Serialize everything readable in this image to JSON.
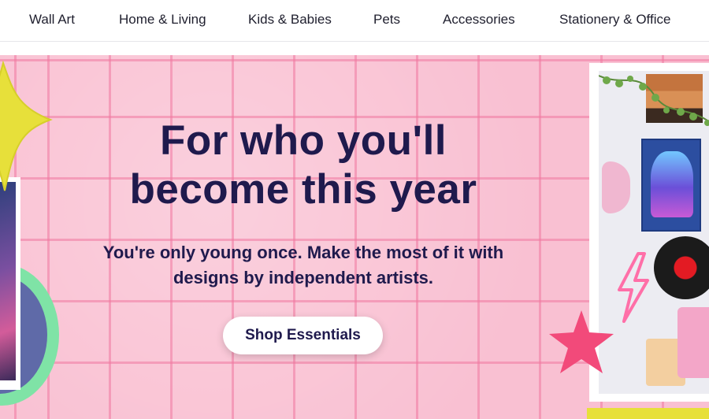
{
  "nav": {
    "items": [
      {
        "label": "Wall Art"
      },
      {
        "label": "Home & Living"
      },
      {
        "label": "Kids & Babies"
      },
      {
        "label": "Pets"
      },
      {
        "label": "Accessories"
      },
      {
        "label": "Stationery & Office"
      }
    ]
  },
  "hero": {
    "title": "For who you'll become this year",
    "subtitle": "You're only young once. Make the most of it with designs by independent artists.",
    "cta_label": "Shop Essentials"
  },
  "colors": {
    "hero_background": "#f9c0d2",
    "grid_lines": "#f078a0",
    "heading_text": "#1f1a4d",
    "star_yellow": "#e7e03a",
    "star_pink": "#f24a7a"
  }
}
